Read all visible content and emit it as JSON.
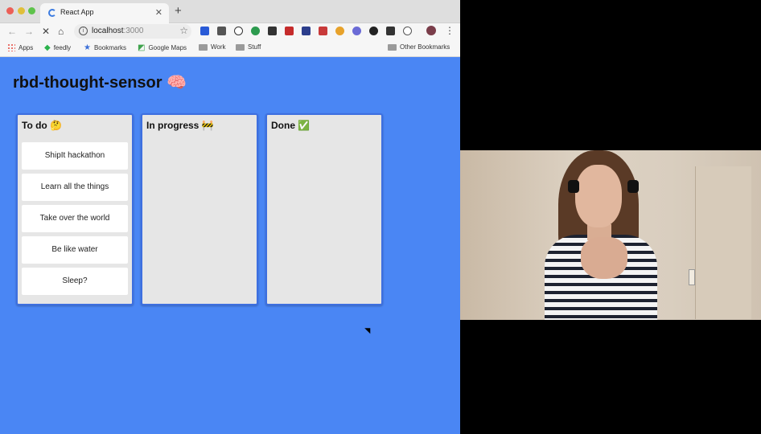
{
  "browser": {
    "tab_title": "React App",
    "url_host": "localhost",
    "url_port": ":3000",
    "bookmarks": [
      {
        "label": "Apps"
      },
      {
        "label": "feedly"
      },
      {
        "label": "Bookmarks"
      },
      {
        "label": "Google Maps"
      },
      {
        "label": "Work"
      },
      {
        "label": "Stuff"
      },
      {
        "label": "Other Bookmarks"
      }
    ]
  },
  "page": {
    "title": "rbd-thought-sensor 🧠",
    "columns": [
      {
        "title": "To do 🤔",
        "tasks": [
          "ShipIt hackathon",
          "Learn all the things",
          "Take over the world",
          "Be like water",
          "Sleep?"
        ]
      },
      {
        "title": "In progress 🚧",
        "tasks": []
      },
      {
        "title": "Done ✅",
        "tasks": []
      }
    ]
  },
  "colors": {
    "page_background": "#4a86f4",
    "column_border": "#3d6fe0",
    "column_background": "#e6e6e6"
  }
}
